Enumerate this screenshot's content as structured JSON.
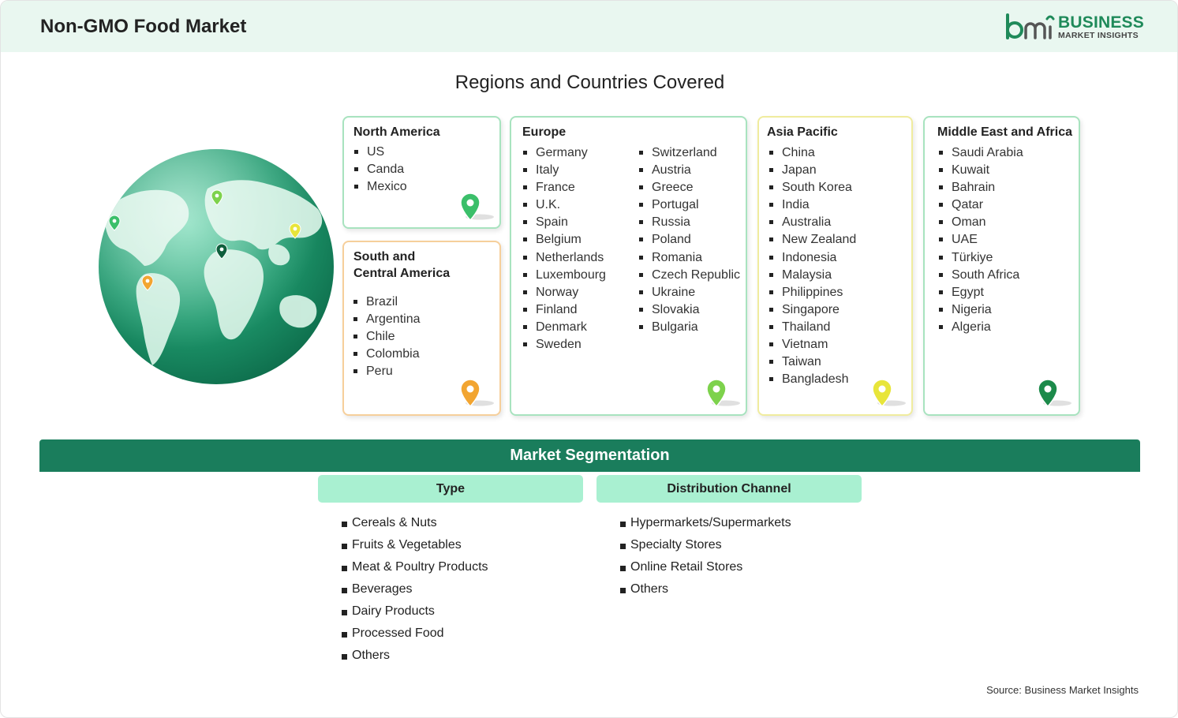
{
  "header": {
    "title": "Non-GMO Food Market",
    "logo_line1": "BUSINESS",
    "logo_line2": "MARKET INSIGHTS"
  },
  "regions_title": "Regions and Countries Covered",
  "regions": {
    "north_america": {
      "title": "North America",
      "countries": [
        "US",
        "Canda",
        "Mexico"
      ],
      "pin_color": "#3bbf6a"
    },
    "south_central_america": {
      "title_line1": "South and",
      "title_line2": "Central America",
      "countries": [
        "Brazil",
        "Argentina",
        "Chile",
        "Colombia",
        "Peru"
      ],
      "pin_color": "#f2a531"
    },
    "europe": {
      "title": "Europe",
      "countries_col1": [
        "Germany",
        "Italy",
        "France",
        "U.K.",
        "Spain",
        "Belgium",
        "Netherlands",
        "Luxembourg",
        "Norway",
        "Finland",
        "Denmark",
        "Sweden"
      ],
      "countries_col2": [
        "Switzerland",
        "Austria",
        "Greece",
        "Portugal",
        "Russia",
        "Poland",
        "Romania",
        "Czech Republic",
        "Ukraine",
        "Slovakia",
        "Bulgaria"
      ],
      "pin_color": "#7dd24c"
    },
    "asia_pacific": {
      "title": "Asia Pacific",
      "countries": [
        "China",
        "Japan",
        "South Korea",
        "India",
        "Australia",
        "New Zealand",
        "Indonesia",
        "Malaysia",
        "Philippines",
        "Singapore",
        "Thailand",
        "Vietnam",
        "Taiwan",
        "Bangladesh"
      ],
      "pin_color": "#e8e53a"
    },
    "middle_east_africa": {
      "title": "Middle East and Africa",
      "countries": [
        "Saudi Arabia",
        "Kuwait",
        "Bahrain",
        "Qatar",
        "Oman",
        "UAE",
        "Türkiye",
        "South Africa",
        "Egypt",
        "Nigeria",
        "Algeria"
      ],
      "pin_color": "#1c8a4a"
    }
  },
  "segmentation": {
    "title": "Market Segmentation",
    "type": {
      "heading": "Type",
      "items": [
        "Cereals & Nuts",
        "Fruits & Vegetables",
        "Meat & Poultry Products",
        "Beverages",
        "Dairy Products",
        "Processed Food",
        "Others"
      ]
    },
    "distribution": {
      "heading": "Distribution Channel",
      "items": [
        "Hypermarkets/Supermarkets",
        "Specialty Stores",
        "Online Retail Stores",
        "Others"
      ]
    }
  },
  "source": "Source: Business Market Insights",
  "colors": {
    "header_bg": "#e9f7f0",
    "brand_green": "#1a7d5c",
    "segment_head_bg": "#a9f0d1"
  }
}
